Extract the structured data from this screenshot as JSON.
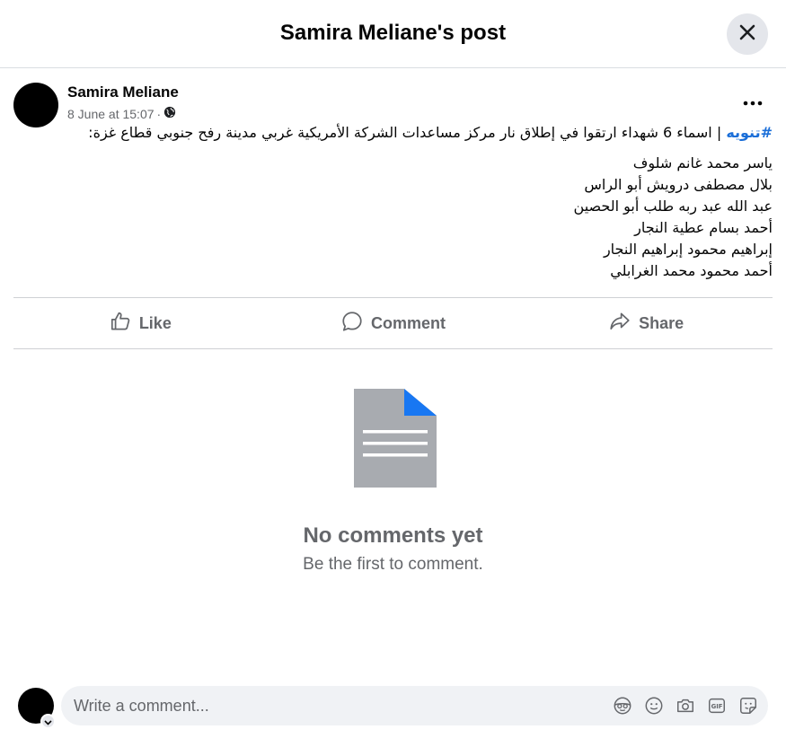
{
  "dialog": {
    "title": "Samira Meliane's post"
  },
  "post": {
    "author": "Samira Meliane",
    "timestamp": "8 June at 15:07",
    "separator": "·",
    "privacy_icon": "globe-icon",
    "hashtag": "#تنويه",
    "lead_text": " | اسماء 6 شهداء ارتقوا في إطلاق نار مركز مساعدات الشركة الأمريكية غربي مدينة رفح جنوبي قطاع غزة:",
    "names": [
      "ياسر محمد غانم شلوف",
      "بلال مصطفى درويش أبو الراس",
      "عبد الله عبد ربه طلب أبو الحصين",
      "أحمد بسام عطية النجار",
      "إبراهيم محمود إبراهيم النجار",
      "أحمد محمود محمد الغرابلي"
    ]
  },
  "actions": {
    "like": "Like",
    "comment": "Comment",
    "share": "Share"
  },
  "empty_state": {
    "title": "No comments yet",
    "subtitle": "Be the first to comment."
  },
  "composer": {
    "placeholder": "Write a comment..."
  },
  "colors": {
    "accent": "#1877f2",
    "hashtag": "#1a6ed8",
    "muted_text": "#65676b",
    "doc_gray": "#a8abb0"
  }
}
